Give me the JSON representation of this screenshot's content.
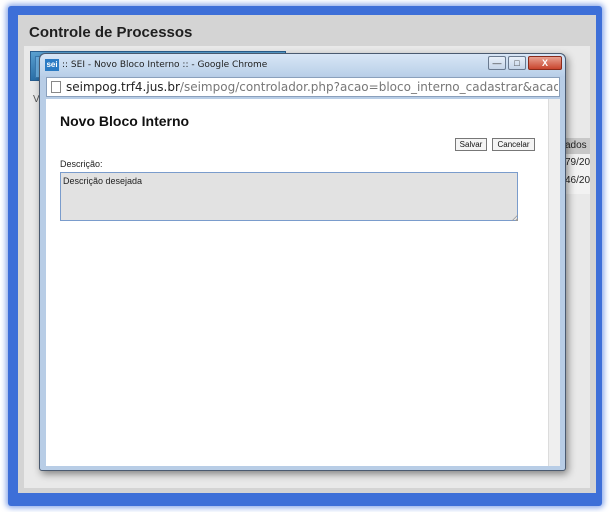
{
  "background": {
    "title": "Controle de Processos",
    "partial_left_text": "V",
    "right_table_header": "ados",
    "right_table_cells": [
      "79/20",
      "46/20"
    ]
  },
  "window": {
    "favicon_text": "sei",
    "title": ":: SEI - Novo Bloco Interno :: - Google Chrome",
    "minimize_glyph": "—",
    "maximize_glyph": "□",
    "close_glyph": "X"
  },
  "address_bar": {
    "host": "seimpog.trf4.jus.br",
    "path": "/seimpog/controlador.php?acao=bloco_interno_cadastrar&acao_origem=bloc"
  },
  "form": {
    "page_title": "Novo Bloco Interno",
    "save_label": "Salvar",
    "cancel_label": "Cancelar",
    "description_label": "Descrição:",
    "description_value": "Descrição desejada"
  },
  "colors": {
    "frame_accent": "#3d6fd8",
    "input_border": "#7a9ccc",
    "close_button": "#c8452e"
  }
}
